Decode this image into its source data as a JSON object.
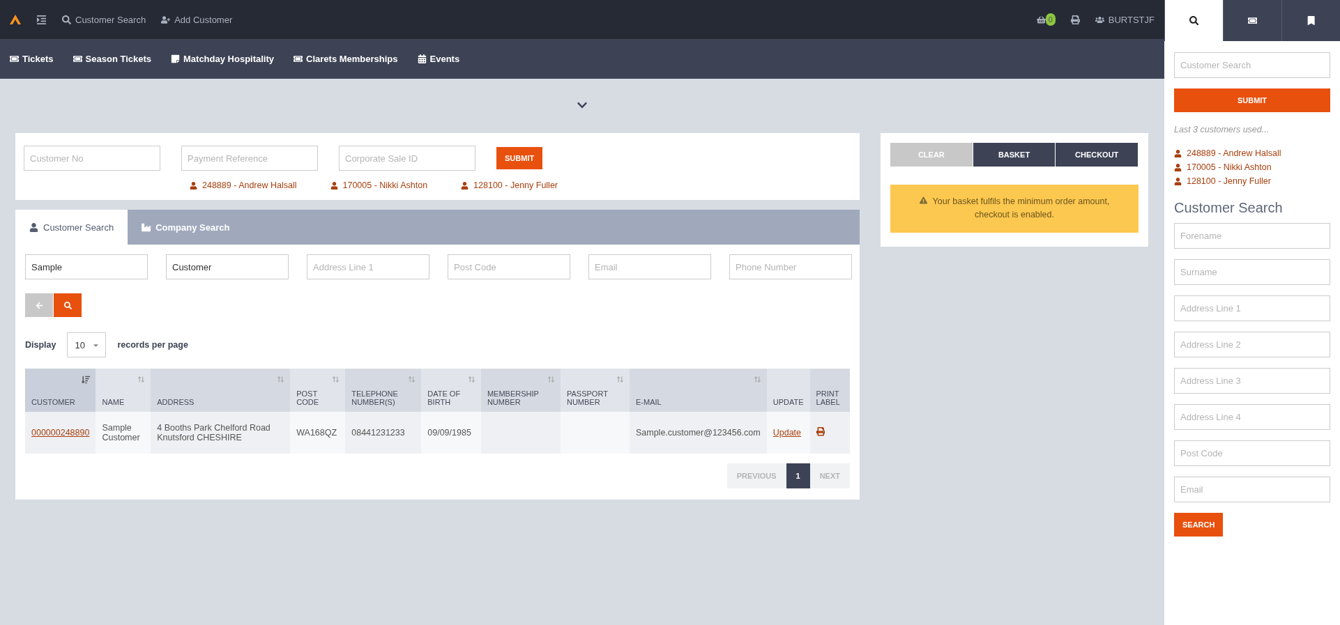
{
  "topbar": {
    "menu": [
      {
        "kind": "search",
        "label": "Customer Search"
      },
      {
        "kind": "add-user",
        "label": "Add Customer"
      }
    ],
    "basket_count": "0",
    "user": "BURTSTJF"
  },
  "nav": [
    {
      "kind": "ticket",
      "label": "Tickets"
    },
    {
      "kind": "ticket",
      "label": "Season Tickets"
    },
    {
      "kind": "hospitality",
      "label": "Matchday Hospitality"
    },
    {
      "kind": "ticket",
      "label": "Clarets Memberships"
    },
    {
      "kind": "calendar",
      "label": "Events"
    }
  ],
  "quick_search": {
    "fields": [
      {
        "placeholder": "Customer No"
      },
      {
        "placeholder": "Payment Reference"
      },
      {
        "placeholder": "Corporate Sale ID"
      }
    ],
    "submit": "SUBMIT",
    "recent": [
      "248889 - Andrew Halsall",
      "170005 - Nikki Ashton",
      "128100 - Jenny Fuller"
    ]
  },
  "basket": {
    "buttons": [
      {
        "label": "CLEAR",
        "disabled": true
      },
      {
        "label": "BASKET",
        "disabled": false
      },
      {
        "label": "CHECKOUT",
        "disabled": false
      }
    ],
    "alert": "Your basket fulfils the minimum order amount, checkout is enabled."
  },
  "search": {
    "tabs": [
      {
        "kind": "person",
        "label": "Customer Search",
        "selected": true
      },
      {
        "kind": "company",
        "label": "Company Search",
        "selected": false
      }
    ],
    "fields": [
      {
        "value": "Sample"
      },
      {
        "value": "Customer"
      },
      {
        "placeholder": "Address Line 1"
      },
      {
        "placeholder": "Post Code"
      },
      {
        "placeholder": "Email"
      },
      {
        "placeholder": "Phone Number"
      }
    ],
    "display_label": "Display",
    "page_size": "10",
    "display_suffix": "records per page",
    "columns": [
      {
        "label": "CUSTOMER",
        "sortable": true,
        "sorted": true
      },
      {
        "label": "NAME",
        "sortable": true,
        "sorted": false
      },
      {
        "label": "ADDRESS",
        "sortable": true,
        "sorted": false
      },
      {
        "label": "POST CODE",
        "sortable": true,
        "sorted": false
      },
      {
        "label": "TELEPHONE NUMBER(S)",
        "sortable": true,
        "sorted": false
      },
      {
        "label": "DATE OF BIRTH",
        "sortable": true,
        "sorted": false
      },
      {
        "label": "MEMBERSHIP NUMBER",
        "sortable": true,
        "sorted": false
      },
      {
        "label": "PASSPORT NUMBER",
        "sortable": true,
        "sorted": false
      },
      {
        "label": "E-MAIL",
        "sortable": true,
        "sorted": false
      },
      {
        "label": "UPDATE",
        "sortable": false
      },
      {
        "label": "PRINT LABEL",
        "sortable": false
      }
    ],
    "rows": [
      {
        "customer": "000000248890",
        "name": "Sample Customer",
        "address": "4 Booths Park Chelford Road Knutsford CHESHIRE",
        "post_code": "WA168QZ",
        "telephone": "08441231233",
        "dob": "09/09/1985",
        "email": "Sample.customer@123456.com",
        "update": "Update"
      }
    ],
    "pagination": [
      {
        "label": "PREVIOUS",
        "selected": false
      },
      {
        "label": "1",
        "selected": true
      },
      {
        "label": "NEXT",
        "selected": false
      }
    ]
  },
  "sidebar": {
    "tabs": [
      {
        "kind": "search",
        "selected": true
      },
      {
        "kind": "ticket",
        "selected": false
      },
      {
        "kind": "bookmark",
        "selected": false
      }
    ],
    "search_placeholder": "Customer Search",
    "submit": "SUBMIT",
    "note": "Last 3 customers used...",
    "recent": [
      "248889 - Andrew Halsall",
      "170005 - Nikki Ashton",
      "128100 - Jenny Fuller"
    ],
    "heading": "Customer Search",
    "fields": [
      {
        "placeholder": "Forename"
      },
      {
        "placeholder": "Surname"
      },
      {
        "placeholder": "Address Line 1"
      },
      {
        "placeholder": "Address Line 2"
      },
      {
        "placeholder": "Address Line 3"
      },
      {
        "placeholder": "Address Line 4"
      },
      {
        "placeholder": "Post Code"
      },
      {
        "placeholder": "Email"
      }
    ],
    "search_button": "SEARCH"
  }
}
